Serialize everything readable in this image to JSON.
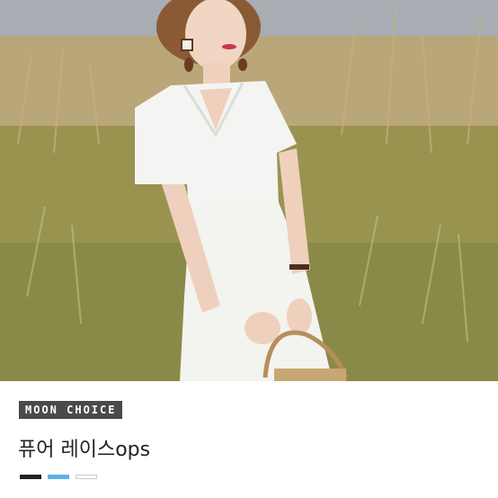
{
  "product_card": {
    "image": {
      "description_icon": "product-photo"
    },
    "badge_label": "MOON CHOICE",
    "product_name": "퓨어 레이스ops",
    "swatches": [
      {
        "name": "black",
        "color": "#222222",
        "border": "#222222"
      },
      {
        "name": "sky-blue",
        "color": "#5fb0e8",
        "border": "#5fb0e8"
      },
      {
        "name": "white",
        "color": "#ffffff",
        "border": "#cccccc"
      }
    ]
  }
}
